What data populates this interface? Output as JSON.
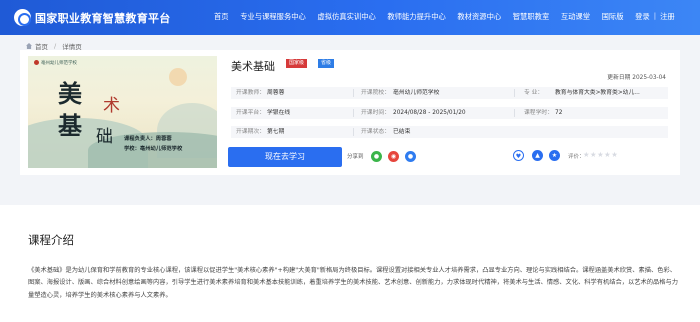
{
  "header": {
    "site_title": "国家职业教育智慧教育平台",
    "nav": [
      "首页",
      "专业与课程服务中心",
      "虚拟仿真实训中心",
      "教师能力提升中心",
      "教材资源中心",
      "智慧职教室",
      "互动课堂",
      "国际版"
    ],
    "login": "登录",
    "separator": "|",
    "register": "注册"
  },
  "breadcrumb": {
    "home": "首页",
    "separator": "/",
    "current": "详情页"
  },
  "cover": {
    "school": "亳州幼儿师范学校",
    "t1": "美",
    "t2": "术",
    "t3": "基",
    "t4": "础",
    "line1": "课程负责人：周蓉蓉",
    "line2": "学校：亳州幼儿师范学校"
  },
  "course": {
    "title": "美术基础",
    "badge_national": "国家级",
    "badge_province": "省级",
    "update_date": "更新日期 2025-03-04",
    "lecturer_label": "开课教师：",
    "lecturer": "周蓉蓉",
    "school_label": "开课院校：",
    "school": "亳州幼儿师范学校",
    "major_label": "专    业：",
    "major": "教育与体育大类>教育类>幼儿...",
    "platform_label": "开课平台：",
    "platform": "学银在线",
    "period_label": "开课时间：",
    "period": "2024/08/28 - 2025/01/20",
    "hours_label": "课程学时：",
    "hours": "72",
    "term_label": "开课期次：",
    "term": "第七期",
    "status_label": "开课状态：",
    "status": "已结束",
    "study_button": "现在去学习",
    "share_label": "分享到",
    "rating_label": "评价："
  },
  "icons": {
    "wechat": "wechat-icon",
    "weibo": "weibo-icon",
    "qq": "qq-icon",
    "heart": "heart-icon",
    "thumb": "thumbs-up-icon",
    "star": "star-icon"
  },
  "rating": {
    "stars": 5,
    "filled": 0
  },
  "intro": {
    "title": "课程介绍",
    "text": "《美术基础》是为幼儿保育和学前教育的专业核心课程，该课程以促进学生\"美术核心素养\"+构建\"大美育\"新格局为终极目标。课程设置对接相关专业人才培养需求，凸显专业方向、理论与实践相结合。课程涵盖美术欣赏、素描、色彩、图案、海报设计、版画、综合材料创意绘画等内容，引导学生进行美术素养培育和美术基本技能训练，着重培养学生的美术技能、艺术创意、创新能力，力求体现时代精神，将美术与生活、情感、文化、科学有机结合，以艺术的品格与力量塑造心灵，培养学生的美术核心素养与人文素养。"
  },
  "colors": {
    "primary": "#2a6ef0",
    "national": "#d63a3a",
    "province": "#2e7de6"
  }
}
